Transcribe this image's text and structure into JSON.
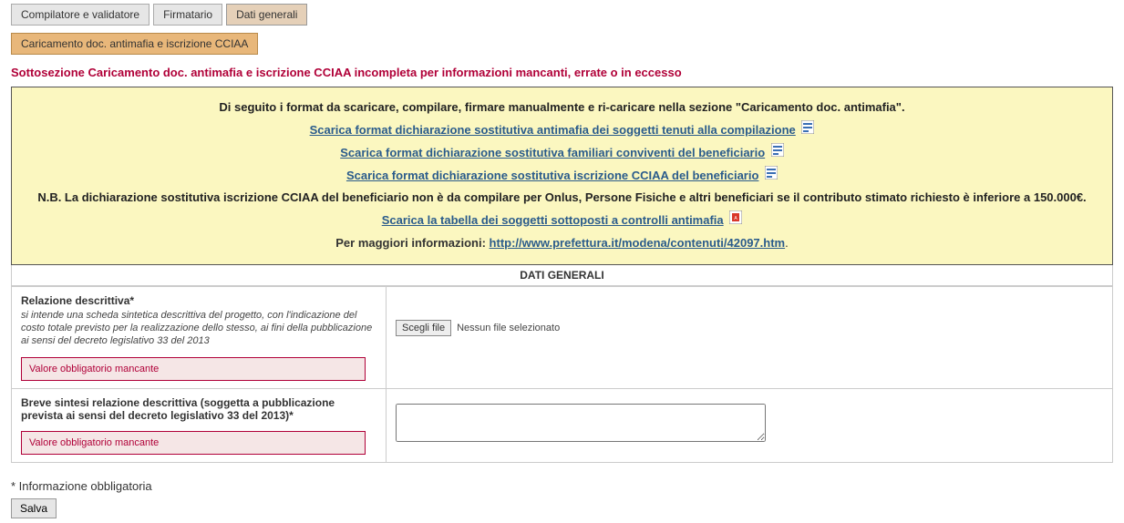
{
  "tabs": {
    "compiler": "Compilatore e validatore",
    "signer": "Firmatario",
    "general": "Dati generali"
  },
  "subtab": "Caricamento doc. antimafia e iscrizione CCIAA",
  "warning": "Sottosezione Caricamento doc. antimafia e iscrizione CCIAA incompleta per informazioni mancanti, errate o in eccesso",
  "info": {
    "intro": "Di seguito i format da scaricare, compilare, firmare manualmente e ri-caricare nella sezione \"Caricamento doc. antimafia\".",
    "link1": "Scarica format dichiarazione sostitutiva antimafia dei soggetti tenuti alla compilazione",
    "link2": "Scarica format dichiarazione sostitutiva familiari conviventi del beneficiario",
    "link3": "Scarica format dichiarazione sostitutiva iscrizione CCIAA del beneficiario",
    "nb": "N.B. La dichiarazione sostitutiva iscrizione CCIAA del beneficiario non è da compilare per Onlus, Persone Fisiche e altri beneficiari se il contributo stimato richiesto è inferiore a 150.000€.",
    "link4": "Scarica la tabella dei soggetti sottoposti a controlli antimafia",
    "more_label": "Per maggiori informazioni: ",
    "more_link": "http://www.prefettura.it/modena/contenuti/42097.htm",
    "more_suffix": "."
  },
  "section_title": "DATI GENERALI",
  "fields": {
    "rel": {
      "label": "Relazione descrittiva*",
      "desc": "si intende una scheda sintetica descrittiva del progetto, con l'indicazione del costo totale previsto per la realizzazione dello stesso, ai fini della pubblicazione ai sensi del decreto legislativo 33 del 2013",
      "error": "Valore obbligatorio mancante",
      "file_btn": "Scegli file",
      "file_status": "Nessun file selezionato"
    },
    "brief": {
      "label": "Breve sintesi relazione descrittiva (soggetta a pubblicazione prevista ai sensi del decreto legislativo 33 del 2013)*",
      "error": "Valore obbligatorio mancante"
    }
  },
  "footer_note": "* Informazione obbligatoria",
  "save": "Salva"
}
